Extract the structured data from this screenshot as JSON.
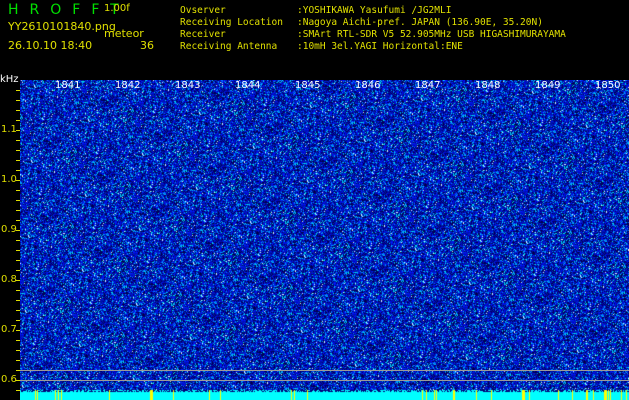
{
  "header": {
    "title": "HROFFT",
    "version": "1.00f",
    "filename": "YY2610101840.png",
    "datetime": "26.10.10 18:40",
    "meteor_label": "meteor",
    "meteor_count": "36"
  },
  "info": [
    {
      "key": "Ovserver",
      "value": ":YOSHIKAWA Yasufumi /JG2MLI"
    },
    {
      "key": "Receiving Location",
      "value": ":Nagoya Aichi-pref. JAPAN (136.90E, 35.20N)"
    },
    {
      "key": "Receiver",
      "value": ":SMArt RTL-SDR V5 52.905MHz USB HIGASHIMURAYAMA"
    },
    {
      "key": "Receiving Antenna",
      "value": ":10mH 3el.YAGI Horizontal:ENE"
    }
  ],
  "axis": {
    "y_unit": "kHz",
    "time_ticks": [
      "1841",
      "1842",
      "1843",
      "1844",
      "1845",
      "1846",
      "1847",
      "1848",
      "1849",
      "1850"
    ],
    "freq_ticks": [
      "1.1",
      "1.0",
      "0.9",
      "0.8",
      "0.7",
      "0.6"
    ]
  },
  "colors": {
    "background": "#000000",
    "waterfall": "#0010c0",
    "signal": "#00ffff",
    "label": "#e0e000"
  }
}
